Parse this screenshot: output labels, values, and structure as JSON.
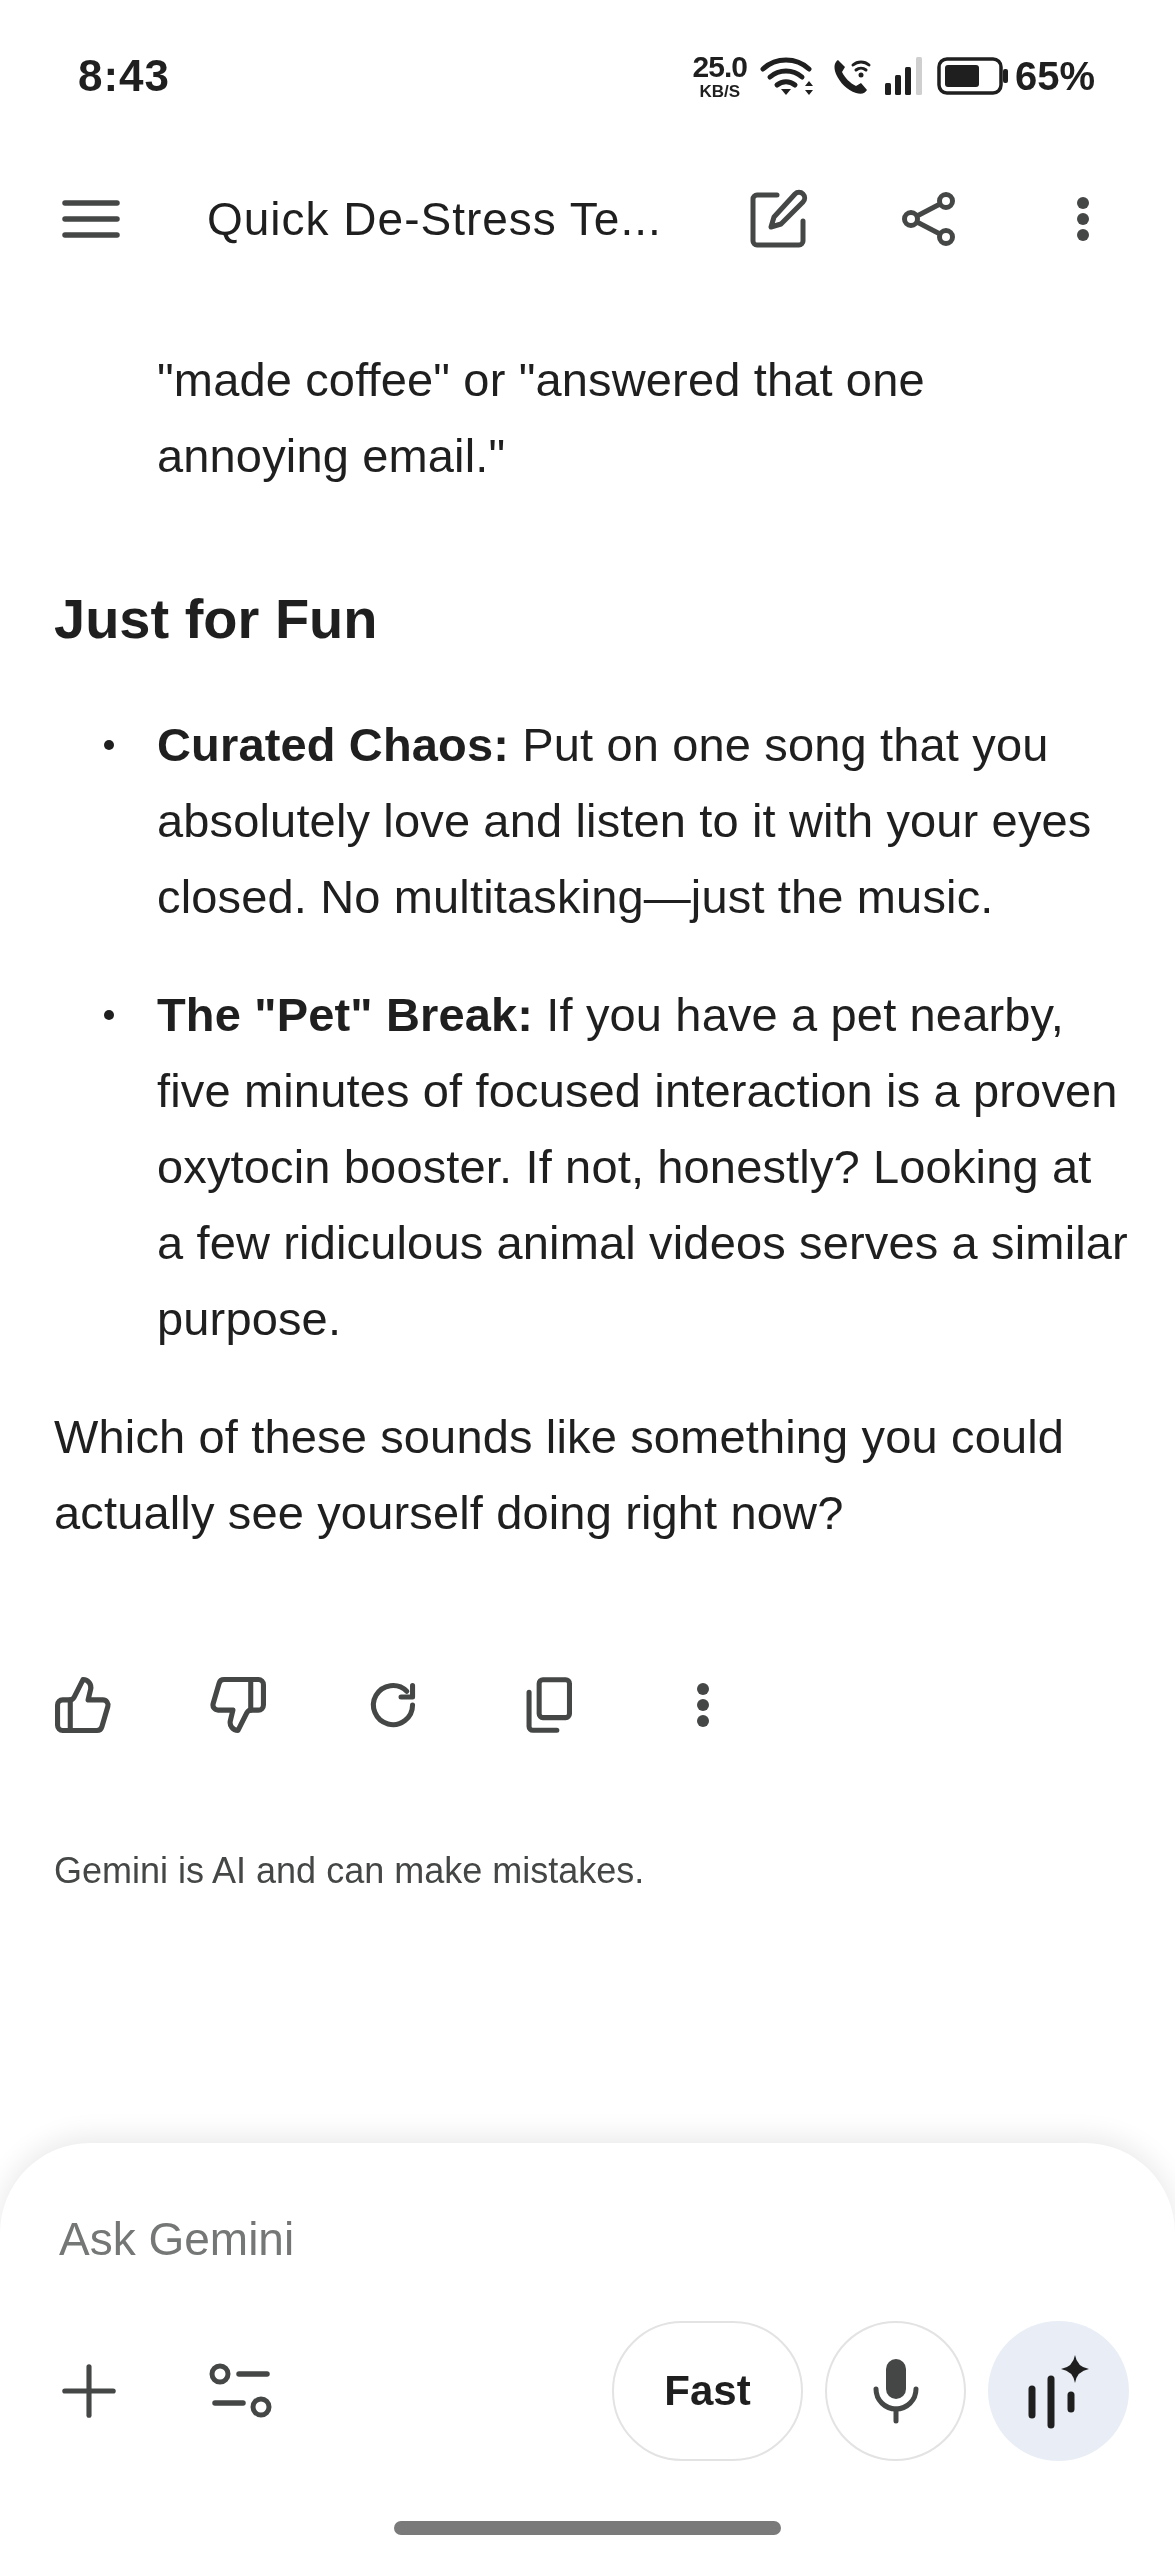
{
  "status_bar": {
    "time": "8:43",
    "network_speed": "25.0",
    "network_speed_unit": "KB/S",
    "battery_percent": "65%"
  },
  "top_bar": {
    "title": "Quick De-Stress Te..."
  },
  "response": {
    "blocks": [
      {
        "kind": "list_continuation",
        "text": "\"made coffee\" or \"answered that one annoying email.\""
      },
      {
        "kind": "heading",
        "text": "Just for Fun"
      },
      {
        "kind": "bullet_list",
        "items": [
          "**Curated Chaos:** Put on one song that you absolutely love and listen to it with your eyes closed. No multitasking—just the music.",
          "**The \"Pet\" Break:** If you have a pet nearby, five minutes of focused interaction is a proven oxytocin booster. If not, honestly? Looking at a few ridiculous animal videos serves a similar purpose."
        ]
      },
      {
        "kind": "paragraph",
        "text": "Which of these sounds like something you could actually see yourself doing right now?"
      }
    ]
  },
  "disclaimer": "Gemini is AI and can make mistakes.",
  "composer": {
    "placeholder": "Ask Gemini",
    "mode_button": "Fast"
  }
}
